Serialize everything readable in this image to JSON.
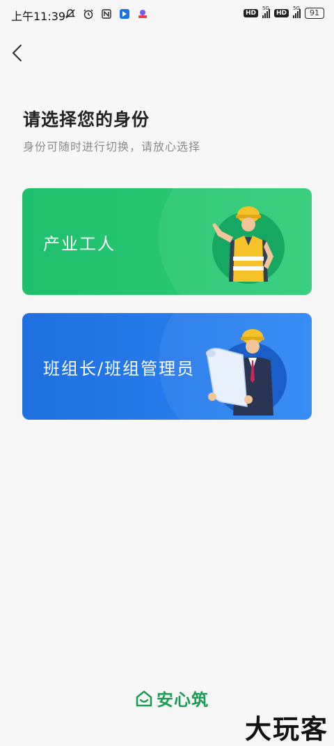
{
  "status_bar": {
    "time": "上午11:39",
    "hd_label": "HD",
    "network": "5G",
    "network_alt": "4G",
    "battery": "91"
  },
  "page": {
    "title": "请选择您的身份",
    "subtitle": "身份可随时进行切换，请放心选择"
  },
  "roles": {
    "worker_label": "产业工人",
    "leader_label": "班组长/班组管理员"
  },
  "footer": {
    "logo_text": "安心筑"
  },
  "watermark": "大玩客",
  "colors": {
    "worker_card": "#22c470",
    "leader_card": "#2a7ff0",
    "brand": "#1c9c55"
  }
}
